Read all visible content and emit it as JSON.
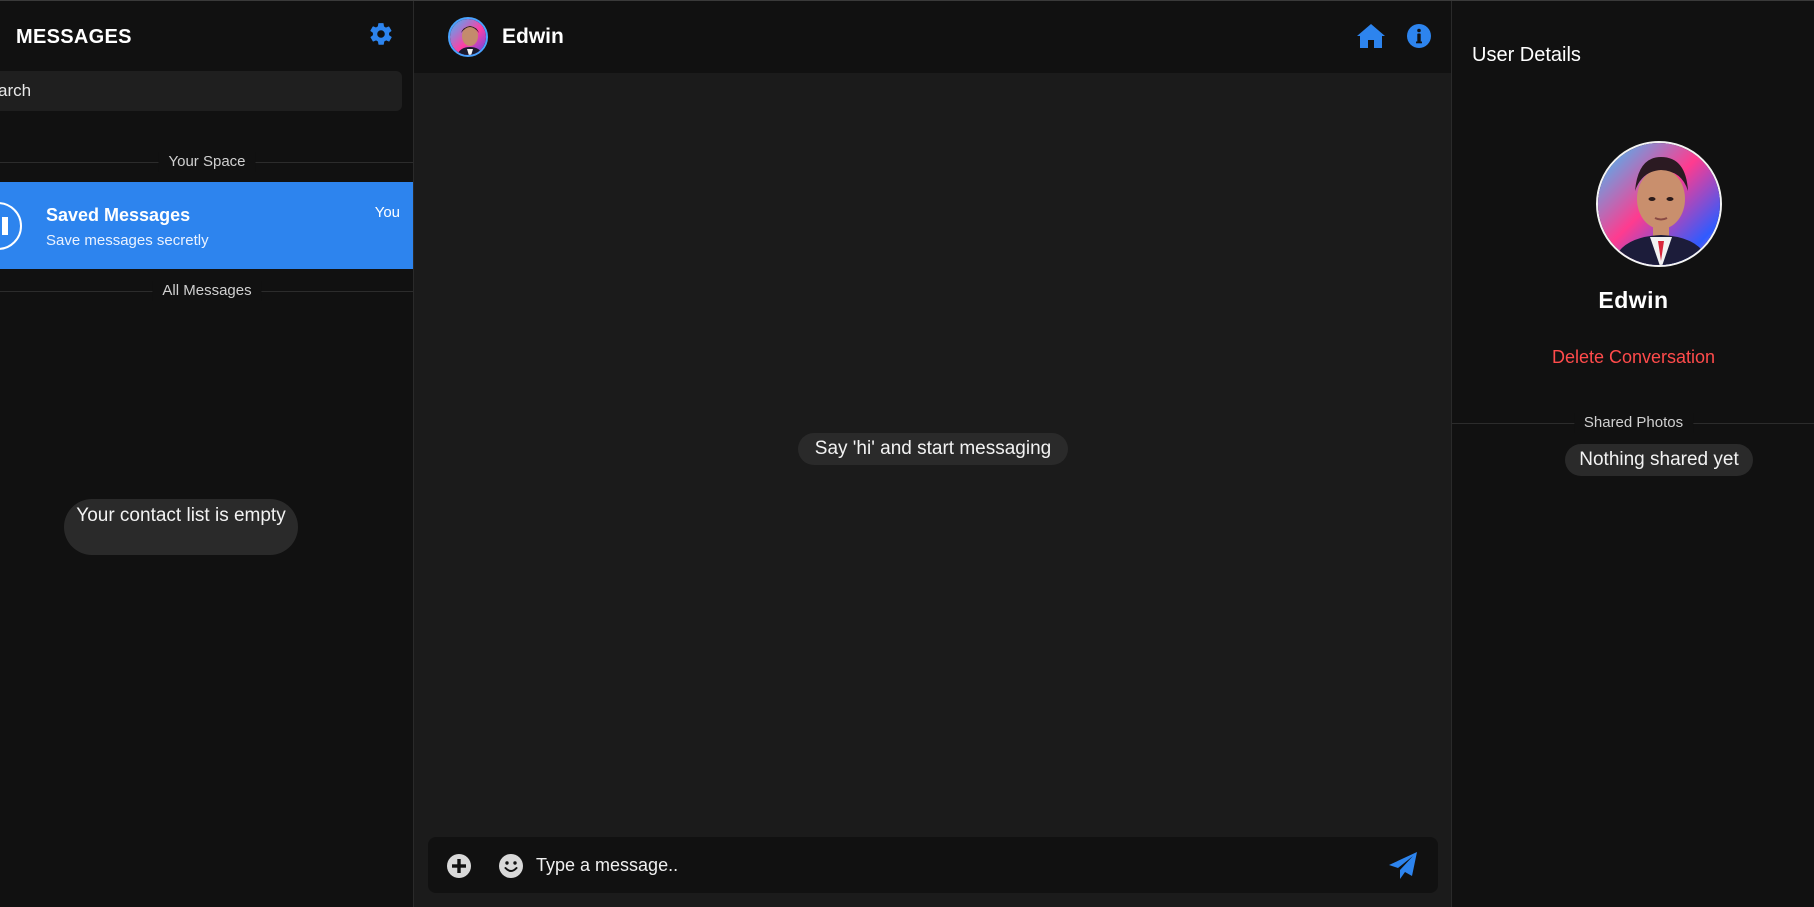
{
  "colors": {
    "accent": "#2d84ee",
    "background": "#111111",
    "chat_background": "#1b1b1b",
    "pill": "#2a2a2a",
    "danger": "#ff4b4b"
  },
  "sidebar": {
    "title": "MESSAGES",
    "settings_icon": "gear-icon",
    "search_value": "arch",
    "your_space_label": "Your Space",
    "saved": {
      "name": "Saved Messages",
      "subtitle": "Save messages secretly",
      "badge": "You"
    },
    "all_messages_label": "All Messages",
    "empty_text": "Your contact list is empty"
  },
  "chat": {
    "contact_name": "Edwin",
    "header_icons": [
      "home-icon",
      "info-icon"
    ],
    "empty_hint": "Say 'hi' and start messaging",
    "composer": {
      "placeholder": "Type a message..",
      "icons": [
        "plus-circle-icon",
        "emoji-icon",
        "send-icon"
      ]
    }
  },
  "details": {
    "title": "User Details",
    "name": "Edwin",
    "delete_label": "Delete Conversation",
    "shared_photos_label": "Shared Photos",
    "shared_empty": "Nothing shared yet"
  }
}
